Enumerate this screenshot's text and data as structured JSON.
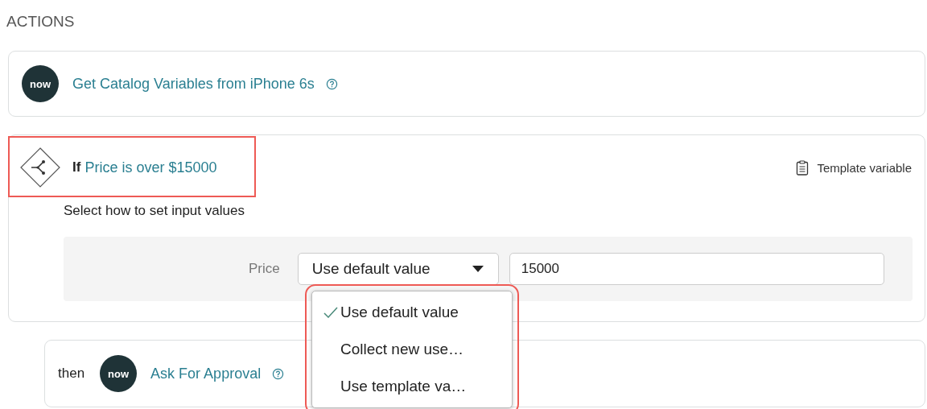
{
  "heading": "ACTIONS",
  "action": {
    "logo": "now",
    "title": "Get Catalog Variables from iPhone 6s"
  },
  "condition": {
    "keyword": "If",
    "title": "Price is over $15000",
    "template_link": "Template variable",
    "instruction": "Select how to set input values",
    "input": {
      "label": "Price",
      "mode": "Use default value",
      "value": "15000",
      "menu": [
        {
          "label": "Use default value",
          "selected": true
        },
        {
          "label": "Collect new use…",
          "selected": false
        },
        {
          "label": "Use template va…",
          "selected": false
        }
      ]
    }
  },
  "next": {
    "keyword": "then",
    "logo": "now",
    "title": "Ask For Approval"
  }
}
